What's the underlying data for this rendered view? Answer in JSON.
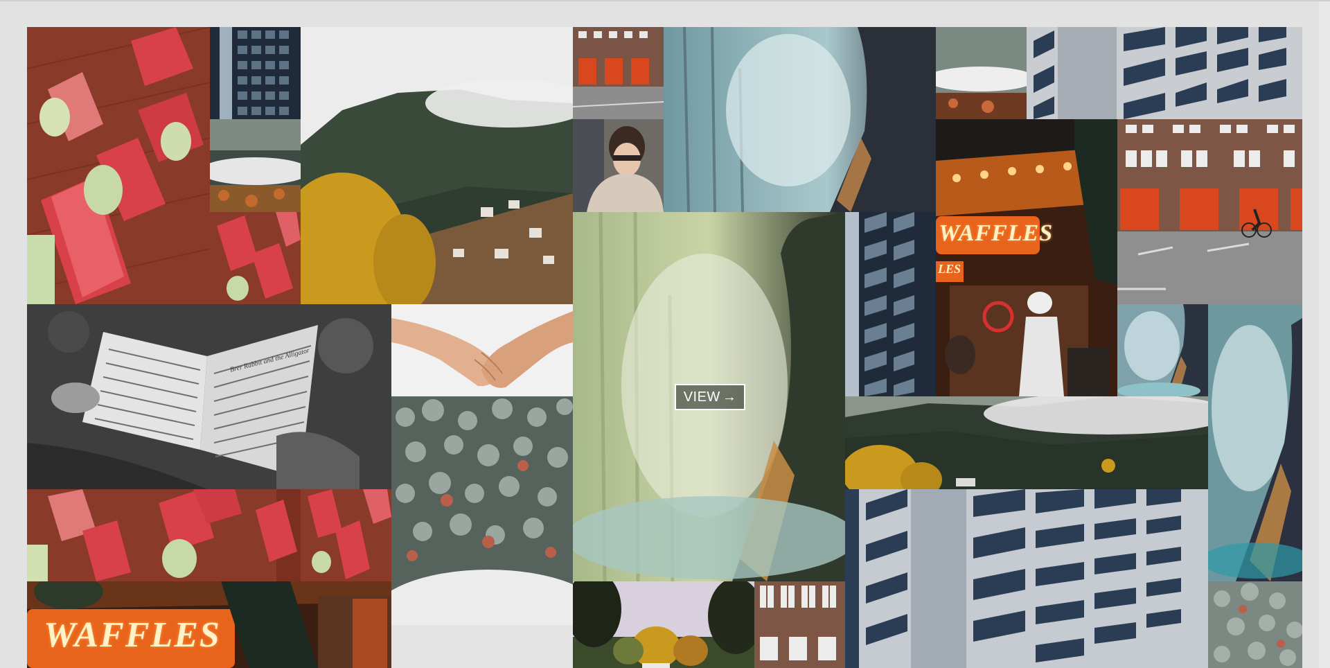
{
  "gallery": {
    "view_label": "VIEW",
    "view_arrow": "→"
  },
  "signs": {
    "waffles": "WAFFLES",
    "waffles_small": "LES",
    "book_heading": "Brer Rabbit and the Alligator"
  },
  "colors": {
    "page_bg": "#e2e2e2",
    "mosaic_bg": "#2c2c2c",
    "brick": "#8a3a28",
    "shutter": "#d9414a",
    "fire_door": "#d9471e",
    "sign_orange": "#e8631c",
    "tower_blue": "#5e7286",
    "smoke_teal": "#8fb2b8",
    "forest_green": "#2f4a38",
    "autumn_gold": "#c99a1d"
  },
  "icons": {
    "view_arrow": "arrow-right-icon"
  }
}
